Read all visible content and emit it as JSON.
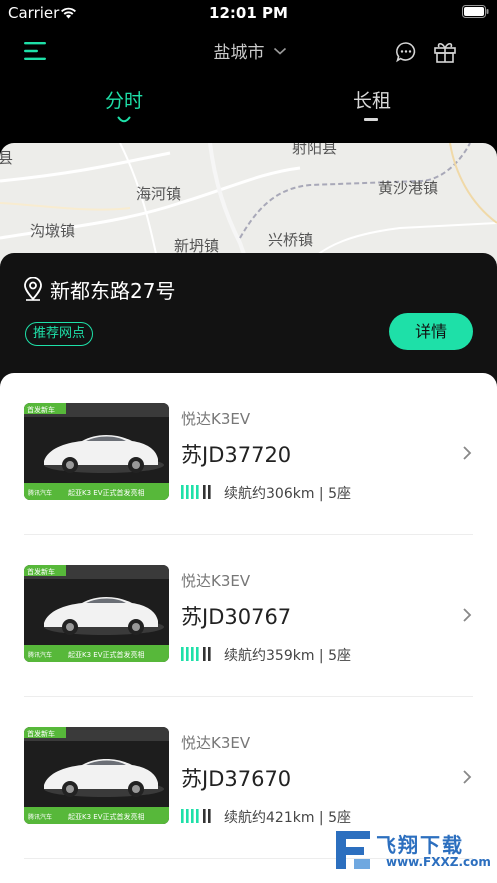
{
  "status_bar": {
    "carrier": "Carrier",
    "time": "12:01 PM"
  },
  "nav": {
    "city": "盐城市"
  },
  "tabs": [
    {
      "label": "分时",
      "active": true
    },
    {
      "label": "长租",
      "active": false
    }
  ],
  "map": {
    "labels": [
      "县",
      "射阳县",
      "海河镇",
      "黄沙港镇",
      "沟墩镇",
      "新坍镇",
      "兴桥镇"
    ]
  },
  "station": {
    "name": "新都东路27号",
    "badge": "推荐网点",
    "detail_button": "详情"
  },
  "cars": [
    {
      "model": "悦达K3EV",
      "plate": "苏JD37720",
      "range": "续航约306km | 5座",
      "image_text": {
        "top": "首发新车",
        "banner": "起亚K3 EV正式首发亮相",
        "brand": "腾讯汽车"
      }
    },
    {
      "model": "悦达K3EV",
      "plate": "苏JD30767",
      "range": "续航约359km | 5座",
      "image_text": {
        "top": "首发新车",
        "banner": "起亚K3 EV正式首发亮相",
        "brand": "腾讯汽车"
      }
    },
    {
      "model": "悦达K3EV",
      "plate": "苏JD37670",
      "range": "续航约421km | 5座",
      "image_text": {
        "top": "首发新车",
        "banner": "起亚K3 EV正式首发亮相",
        "brand": "腾讯汽车"
      }
    }
  ],
  "watermark": {
    "logo": "飞翔下载",
    "url": "www.FXXZ.com"
  },
  "colors": {
    "accent": "#1ee0a8",
    "background": "#000000",
    "panel": "#121212"
  }
}
